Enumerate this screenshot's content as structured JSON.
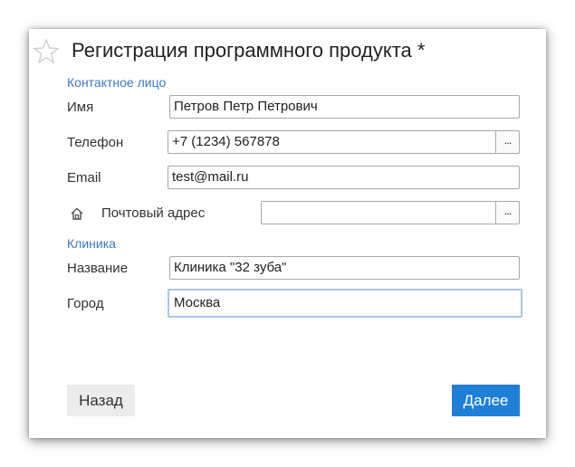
{
  "dialog": {
    "title": "Регистрация программного продукта *"
  },
  "contact": {
    "section_label": "Контактное лицо",
    "name_label": "Имя",
    "name_value": "Петров Петр Петрович",
    "phone_label": "Телефон",
    "phone_value": "+7 (1234) 567878",
    "email_label": "Email",
    "email_value": "test@mail.ru",
    "address_label": "Почтовый адрес",
    "address_value": "",
    "choose_button": "..."
  },
  "clinic": {
    "section_label": "Клиника",
    "name_label": "Название",
    "name_value": "Клиника \"32 зуба\"",
    "city_label": "Город",
    "city_value": "Москва"
  },
  "footer": {
    "back_label": "Назад",
    "next_label": "Далее"
  },
  "colors": {
    "accent": "#1f7fd6",
    "section_text": "#3b78c2",
    "focus_border": "#a9c5e8"
  },
  "icons": {
    "favorite": "star-outline-icon",
    "address": "home-icon"
  }
}
